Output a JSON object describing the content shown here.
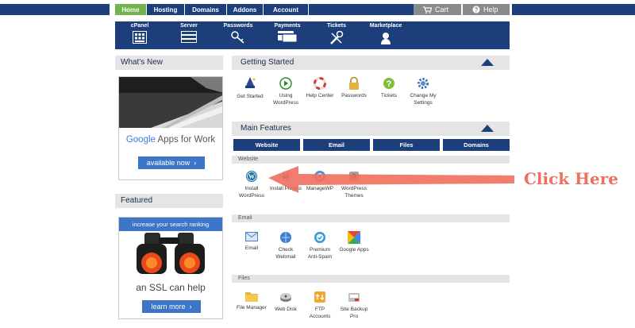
{
  "topnav": {
    "tabs": [
      {
        "label": "Home",
        "active": true
      },
      {
        "label": "Hosting",
        "active": false
      },
      {
        "label": "Domains",
        "active": false
      },
      {
        "label": "Addons",
        "active": false
      },
      {
        "label": "Account",
        "active": false
      }
    ],
    "cart_label": "Cart",
    "help_label": "Help"
  },
  "iconbar": [
    {
      "label": "cPanel",
      "icon": "cpanel-grid-icon"
    },
    {
      "label": "Server",
      "icon": "server-icon"
    },
    {
      "label": "Passwords",
      "icon": "key-icon"
    },
    {
      "label": "Payments",
      "icon": "credit-card-icon"
    },
    {
      "label": "Tickets",
      "icon": "tools-icon"
    },
    {
      "label": "Marketplace",
      "icon": "marketplace-icon"
    }
  ],
  "sidebar": {
    "whats_new_title": "What's New",
    "google_ad": {
      "google": "Google",
      "apps": "Apps for Work",
      "button": "available now"
    },
    "featured_title": "Featured",
    "ssl_ad": {
      "banner": "increase your search ranking",
      "text": "an SSL can help",
      "button": "learn more"
    }
  },
  "getting_started": {
    "title": "Getting Started",
    "items": [
      {
        "label": "Get Started",
        "icon": "wizard-icon"
      },
      {
        "label": "Using\nWordPress",
        "icon": "play-icon"
      },
      {
        "label": "Help Center",
        "icon": "lifebuoy-icon"
      },
      {
        "label": "Passwords",
        "icon": "lock-icon"
      },
      {
        "label": "Tickets",
        "icon": "question-icon"
      },
      {
        "label": "Change My\nSettings",
        "icon": "gear-icon"
      }
    ]
  },
  "main_features": {
    "title": "Main Features",
    "tabs": [
      "Website",
      "Email",
      "Files",
      "Domains"
    ],
    "website": {
      "title": "Website",
      "items": [
        {
          "label": "Install\nWordPress",
          "icon": "wordpress-icon"
        },
        {
          "label": "Install Plugins",
          "icon": "plugin-icon"
        },
        {
          "label": "ManageWP",
          "icon": "managewp-icon"
        },
        {
          "label": "WordPress\nThemes",
          "icon": "themes-icon"
        }
      ]
    },
    "email": {
      "title": "Email",
      "items": [
        {
          "label": "Email",
          "icon": "envelope-icon"
        },
        {
          "label": "Check\nWebmail",
          "icon": "webmail-icon"
        },
        {
          "label": "Premium\nAnti-Spam",
          "icon": "shield-icon"
        },
        {
          "label": "Google Apps",
          "icon": "google-apps-icon"
        }
      ]
    },
    "files": {
      "title": "Files",
      "items": [
        {
          "label": "File Manager",
          "icon": "folder-icon"
        },
        {
          "label": "Web Disk",
          "icon": "disk-icon"
        },
        {
          "label": "FTP\nAccounts",
          "icon": "ftp-icon"
        },
        {
          "label": "Site Backup\nPro",
          "icon": "backup-icon"
        }
      ]
    }
  },
  "annotation": {
    "text": "Click Here",
    "color": "#ef6f5e"
  },
  "colors": {
    "nav_blue": "#1c3f7c",
    "active_green": "#71b44c",
    "gray_bar": "#888a8c"
  }
}
